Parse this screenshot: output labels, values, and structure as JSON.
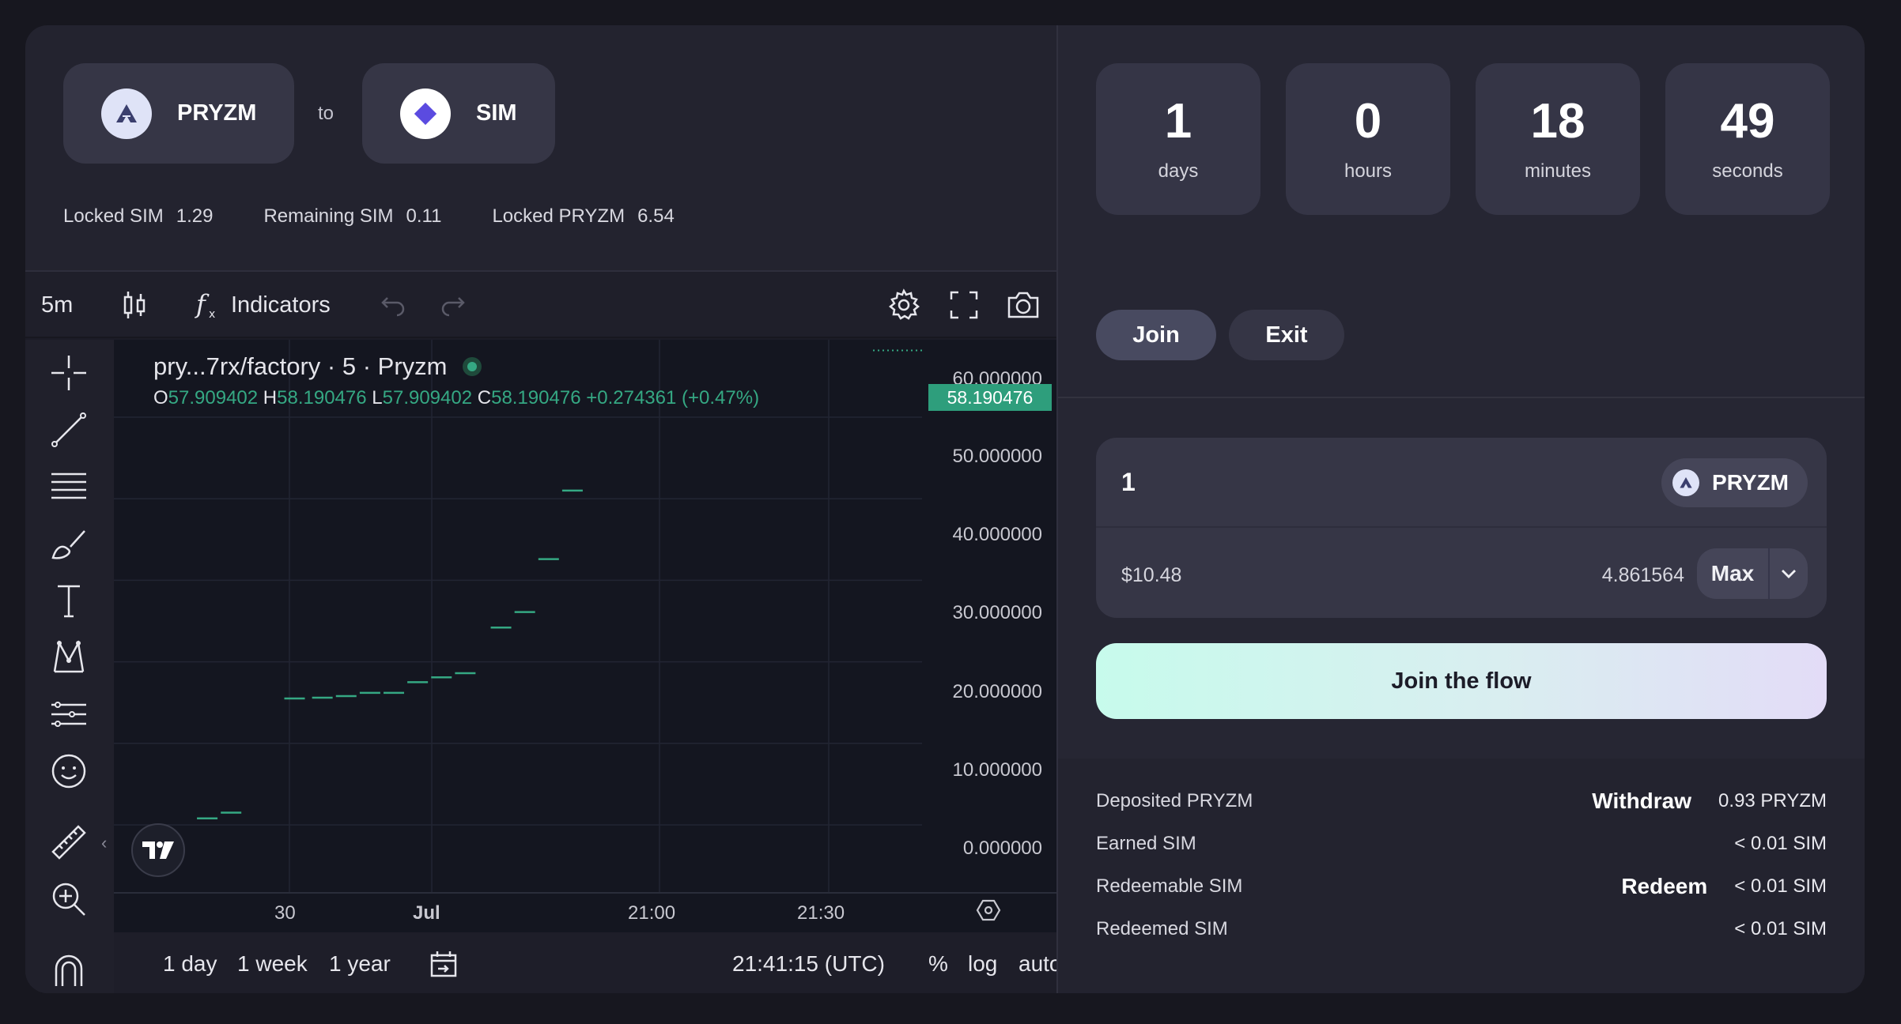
{
  "swap": {
    "from_token": "PRYZM",
    "to_label": "to",
    "to_token": "SIM"
  },
  "stats": [
    {
      "label": "Locked SIM",
      "value": "1.29"
    },
    {
      "label": "Remaining SIM",
      "value": "0.11"
    },
    {
      "label": "Locked PRYZM",
      "value": "6.54"
    }
  ],
  "toolbar": {
    "interval": "5m",
    "indicators_label": "Indicators"
  },
  "chart_legend": {
    "symbol": "pry...7rx/factory · 5 · Pryzm",
    "o_label": "O",
    "o_value": "57.909402",
    "h_label": "H",
    "h_value": "58.190476",
    "l_label": "L",
    "l_value": "57.909402",
    "c_label": "C",
    "c_value": "58.190476",
    "change": "+0.274361 (+0.47%)",
    "last_price": "58.190476",
    "partial_top_tick": "60.000000"
  },
  "chart_data": {
    "type": "line",
    "style": "horizontal steps (tick marks)",
    "x_ticks": [
      "30",
      "Jul",
      "21:00",
      "21:30"
    ],
    "y_ticks": [
      "50.000000",
      "40.000000",
      "30.000000",
      "20.000000",
      "10.000000",
      "0.000000"
    ],
    "ylim": [
      -2,
      60
    ],
    "points": [
      {
        "x": 0.04,
        "y": 0.8
      },
      {
        "x": 0.1,
        "y": 1.5
      },
      {
        "x": 0.26,
        "y": 15.5
      },
      {
        "x": 0.33,
        "y": 15.6
      },
      {
        "x": 0.39,
        "y": 15.8
      },
      {
        "x": 0.45,
        "y": 16.2
      },
      {
        "x": 0.51,
        "y": 16.2
      },
      {
        "x": 0.57,
        "y": 17.5
      },
      {
        "x": 0.63,
        "y": 18.1
      },
      {
        "x": 0.69,
        "y": 18.6
      },
      {
        "x": 0.78,
        "y": 24.2
      },
      {
        "x": 0.84,
        "y": 26.1
      },
      {
        "x": 0.9,
        "y": 32.6
      },
      {
        "x": 0.96,
        "y": 41.0
      }
    ],
    "grid": true,
    "last_value": 58.190476
  },
  "footer": {
    "range_1d": "1 day",
    "range_1w": "1 week",
    "range_1y": "1 year",
    "time": "21:41:15 (UTC)",
    "percent": "%",
    "log": "log",
    "auto": "auto"
  },
  "countdown": [
    {
      "value": "1",
      "unit": "days"
    },
    {
      "value": "0",
      "unit": "hours"
    },
    {
      "value": "18",
      "unit": "minutes"
    },
    {
      "value": "49",
      "unit": "seconds"
    }
  ],
  "tabs": {
    "join": "Join",
    "exit": "Exit"
  },
  "input": {
    "amount": "1",
    "token": "PRYZM",
    "usd_value": "$10.48",
    "balance": "4.861564",
    "max_label": "Max"
  },
  "cta": "Join the flow",
  "info": [
    {
      "label": "Deposited PRYZM",
      "action": "Withdraw",
      "value": "0.93 PRYZM"
    },
    {
      "label": "Earned SIM",
      "action": "",
      "value": "< 0.01 SIM"
    },
    {
      "label": "Redeemable SIM",
      "action": "Redeem",
      "value": "< 0.01 SIM"
    },
    {
      "label": "Redeemed SIM",
      "action": "",
      "value": "< 0.01 SIM"
    }
  ],
  "colors": {
    "accent_green": "#35a883",
    "sim_logo": "#5b4be0",
    "pryzm_logo_bg": "#dfe3f7"
  },
  "icons": [
    "candles-icon",
    "function-icon",
    "undo-icon",
    "redo-icon",
    "settings-icon",
    "fullscreen-icon",
    "camera-icon",
    "crosshair-icon",
    "trendline-icon",
    "fib-icon",
    "brush-icon",
    "text-icon",
    "pattern-icon",
    "forecast-icon",
    "emoji-icon",
    "ruler-icon",
    "zoom-icon",
    "magnet-icon",
    "calendar-icon",
    "chevron-down-icon",
    "tradingview-logo-icon"
  ]
}
